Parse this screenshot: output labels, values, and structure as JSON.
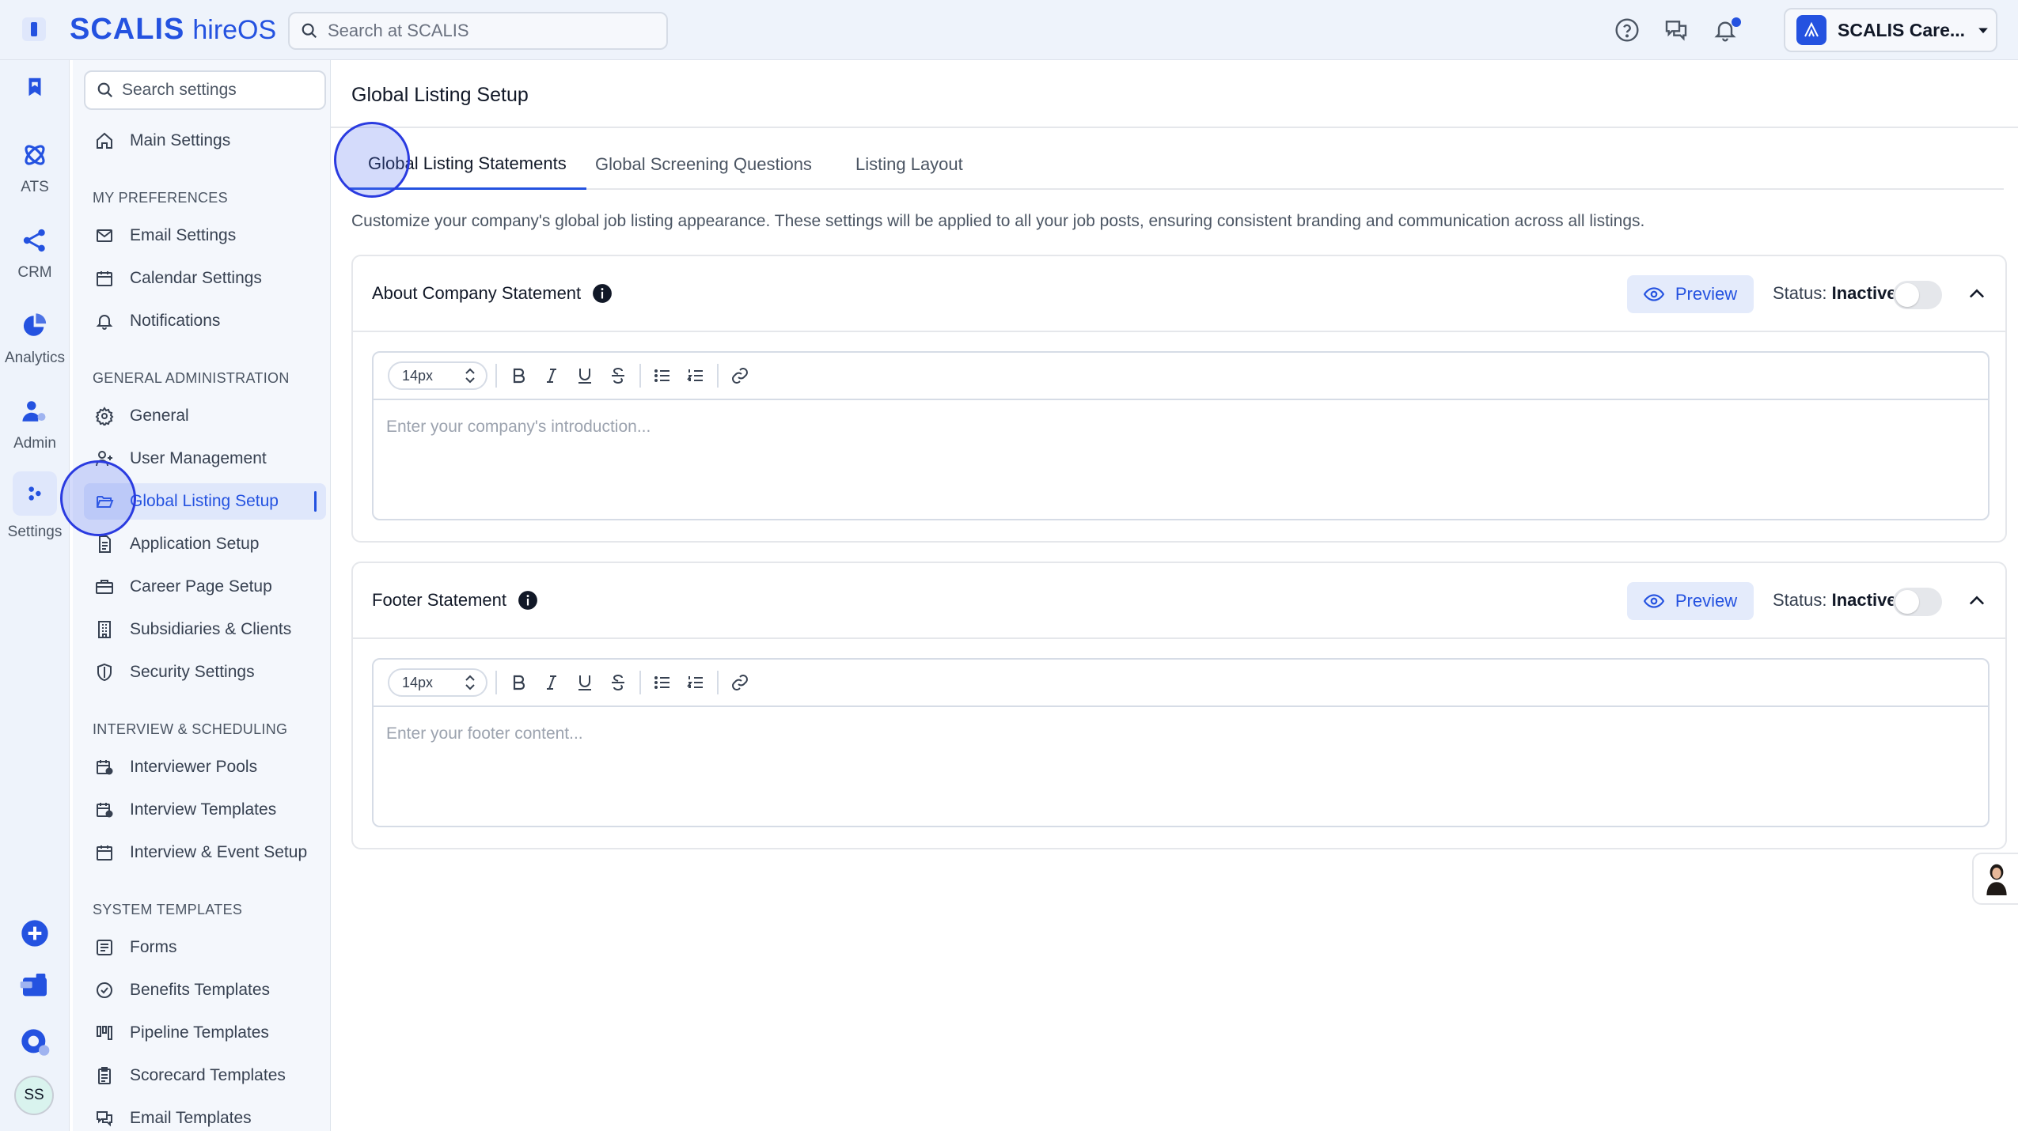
{
  "brand": {
    "name": "SCALIS",
    "product": "hireOS"
  },
  "top_search": {
    "placeholder": "Search at SCALIS"
  },
  "account": {
    "name": "SCALIS Care..."
  },
  "rail": {
    "items": [
      {
        "label": ""
      },
      {
        "label": "ATS"
      },
      {
        "label": "CRM"
      },
      {
        "label": "Analytics"
      },
      {
        "label": "Admin"
      },
      {
        "label": "Settings"
      }
    ],
    "user_initials": "SS"
  },
  "settings_nav": {
    "search_placeholder": "Search settings",
    "main_settings": "Main Settings",
    "sections": {
      "my_preferences": "MY PREFERENCES",
      "general_admin": "GENERAL ADMINISTRATION",
      "interview": "INTERVIEW & SCHEDULING",
      "system_templates": "SYSTEM TEMPLATES"
    },
    "items": {
      "email_settings": "Email Settings",
      "calendar_settings": "Calendar Settings",
      "notifications": "Notifications",
      "general": "General",
      "user_management": "User Management",
      "global_listing_setup": "Global Listing Setup",
      "application_setup": "Application Setup",
      "career_page_setup": "Career Page Setup",
      "subsidiaries_clients": "Subsidiaries & Clients",
      "security_settings": "Security Settings",
      "interviewer_pools": "Interviewer Pools",
      "interview_templates": "Interview Templates",
      "interview_event_setup": "Interview & Event Setup",
      "forms": "Forms",
      "benefits_templates": "Benefits Templates",
      "pipeline_templates": "Pipeline Templates",
      "scorecard_templates": "Scorecard Templates",
      "email_templates": "Email Templates"
    }
  },
  "main": {
    "title": "Global Listing Setup",
    "tabs": [
      {
        "label": "Global Listing Statements",
        "active": true
      },
      {
        "label": "Global Screening Questions",
        "active": false
      },
      {
        "label": "Listing Layout",
        "active": false
      }
    ],
    "description": "Customize your company's global job listing appearance. These settings will be applied to all your job posts, ensuring consistent branding and communication across all listings.",
    "cards": [
      {
        "title": "About Company Statement",
        "preview_label": "Preview",
        "status_label": "Status:",
        "status_value": "Inactive",
        "font_size": "14px",
        "placeholder": "Enter your company's introduction..."
      },
      {
        "title": "Footer Statement",
        "preview_label": "Preview",
        "status_label": "Status:",
        "status_value": "Inactive",
        "font_size": "14px",
        "placeholder": "Enter your footer content..."
      }
    ]
  },
  "colors": {
    "accent": "#2452e0",
    "rail_bg": "#eef3fb",
    "active_bg": "#dfe7fb"
  }
}
